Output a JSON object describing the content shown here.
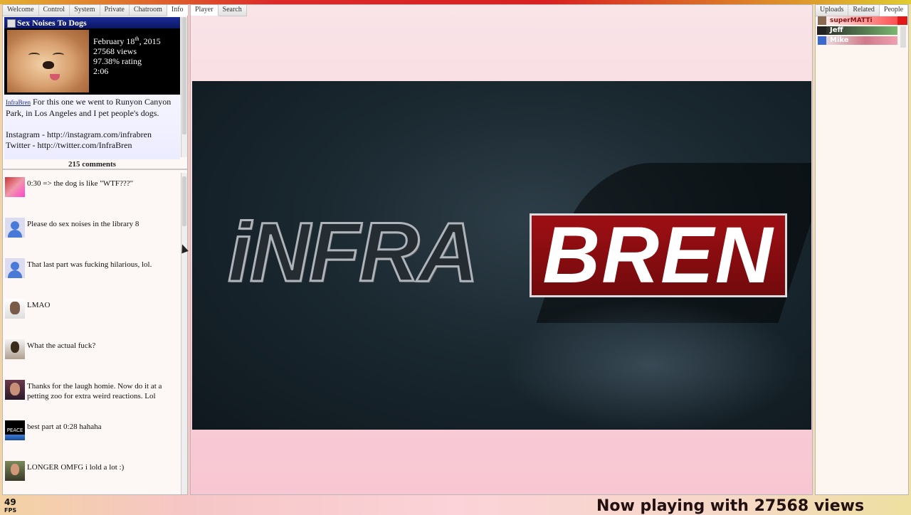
{
  "left_tabs": [
    "Welcome",
    "Control",
    "System",
    "Private",
    "Chatroom",
    "Info"
  ],
  "video": {
    "title": "Sex Noises To Dogs",
    "date_prefix": "February 18",
    "date_sup": "th",
    "date_suffix": ", 2015",
    "views": "27568 views",
    "rating": "97.38% rating",
    "duration": "2:06",
    "uploader": "InfraBren",
    "description": "For this one we went to Runyon Canyon Park, in Los Angeles and I pet people's dogs.",
    "instagram": "Instagram - http://instagram.com/infrabren",
    "twitter_partial": "Twitter - http://twitter.com/InfraBren"
  },
  "comments_count": "215 comments",
  "comments": [
    {
      "text": "0:30 => the dog is like \"WTF???\"",
      "avatar": "red-pattern-avatar"
    },
    {
      "text": "Please do sex noises in the library 8",
      "avatar": "default-user-icon"
    },
    {
      "text": "That last part was fucking hilarious, lol.",
      "avatar": "default-user-icon"
    },
    {
      "text": "LMAO",
      "avatar": "photo-avatar"
    },
    {
      "text": "What the actual fuck?",
      "avatar": "photo-avatar"
    },
    {
      "text": "Thanks for the laugh homie. Now do it at a petting zoo for extra weird reactions. Lol",
      "avatar": "photo-avatar"
    },
    {
      "text": "best part at 0:28 hahaha",
      "avatar": "peace-avatar",
      "avatar_text": "PEACE"
    },
    {
      "text": "LONGER OMFG i lold a lot :)",
      "avatar": "photo-avatar"
    }
  ],
  "fps": {
    "value": "49",
    "label": "FPS"
  },
  "center_tabs": [
    "Player",
    "Search"
  ],
  "player": {
    "logo_left": "iNFRA",
    "logo_right": "BREN"
  },
  "now_playing": "Now playing with 27568 views",
  "right_tabs": [
    "Uploads",
    "Related",
    "People"
  ],
  "people": [
    "superMATTi",
    "Jeff",
    "Mike"
  ],
  "colors": {
    "title_bar": "#0c1660",
    "logo_red": "#9e0f14",
    "top_accent": "#d82020"
  }
}
